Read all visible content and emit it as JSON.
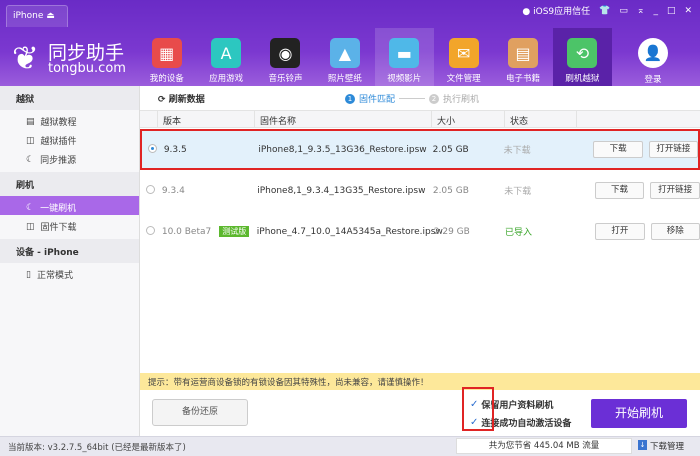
{
  "device_tab": {
    "label": "iPhone",
    "icon": "apple-icon"
  },
  "topbar": {
    "trust_label": "iOS9应用信任"
  },
  "logo": {
    "name": "同步助手",
    "domain": "tongbu.com"
  },
  "nav": [
    {
      "label": "我的设备",
      "icon": "store-icon",
      "color": "#e84b4b"
    },
    {
      "label": "应用游戏",
      "icon": "app-store-icon",
      "color": "#2cc7c0"
    },
    {
      "label": "音乐铃声",
      "icon": "vinyl-icon",
      "color": "#222222"
    },
    {
      "label": "照片壁纸",
      "icon": "photo-icon",
      "color": "#5bb2e8"
    },
    {
      "label": "视频影片",
      "icon": "clapper-icon",
      "color": "#4fb8e8"
    },
    {
      "label": "文件管理",
      "icon": "folder-icon",
      "color": "#f2a52a"
    },
    {
      "label": "电子书籍",
      "icon": "book-icon",
      "color": "#e0a060"
    },
    {
      "label": "刷机越狱",
      "icon": "flash-icon",
      "color": "#4cc468"
    }
  ],
  "login": {
    "label": "登录"
  },
  "sidebar": {
    "sections": [
      {
        "title": "越狱",
        "items": [
          {
            "label": "越狱教程",
            "icon": "book-icon"
          },
          {
            "label": "越狱插件",
            "icon": "box-icon"
          },
          {
            "label": "同步推源",
            "icon": "tongbu-icon"
          }
        ]
      },
      {
        "title": "刷机",
        "items": [
          {
            "label": "一键刷机",
            "icon": "tongbu-icon",
            "active": true
          },
          {
            "label": "固件下载",
            "icon": "box-icon"
          }
        ]
      },
      {
        "title": "设备 - iPhone",
        "items": [
          {
            "label": "正常模式",
            "icon": "phone-icon"
          }
        ]
      }
    ]
  },
  "toolbar": {
    "refresh": "刷新数据"
  },
  "steps": [
    {
      "num": "1",
      "label": "固件匹配"
    },
    {
      "num": "2",
      "label": "执行刷机"
    }
  ],
  "table": {
    "headers": [
      "版本",
      "固件名称",
      "大小",
      "状态"
    ],
    "rows": [
      {
        "version": "9.3.5",
        "name": "iPhone8,1_9.3.5_13G36_Restore.ipsw",
        "size": "2.05 GB",
        "status": "未下载",
        "btn1": "下载",
        "btn2": "打开链接",
        "selected": true
      },
      {
        "version": "9.3.4",
        "name": "iPhone8,1_9.3.4_13G35_Restore.ipsw",
        "size": "2.05 GB",
        "status": "未下载",
        "btn1": "下载",
        "btn2": "打开链接"
      },
      {
        "version": "10.0 Beta7",
        "badge": "测试版",
        "name": "iPhone_4.7_10.0_14A5345a_Restore.ipsw",
        "size": "2.29 GB",
        "status": "已导入",
        "btn1": "打开",
        "btn2": "移除"
      }
    ]
  },
  "tip": "提示：带有运营商设备锁的有锁设备因其特殊性，尚未兼容，请谨慎操作！",
  "backup_button": "备份还原",
  "options": [
    {
      "label": "保留用户资料刷机",
      "checked": true
    },
    {
      "label": "连接成功自动激活设备",
      "checked": true
    }
  ],
  "start_button": "开始刷机",
  "status": {
    "version": "当前版本: v3.2.7.5_64bit  (已经是最新版本了)",
    "saved": "共为您节省  445.04 MB 流量",
    "download_manager": "下载管理"
  },
  "colors": {
    "accent": "#6b2fd6",
    "selected_row": "#e3f1fb",
    "highlight_border": "#e02424",
    "imported": "#3aa52a"
  }
}
